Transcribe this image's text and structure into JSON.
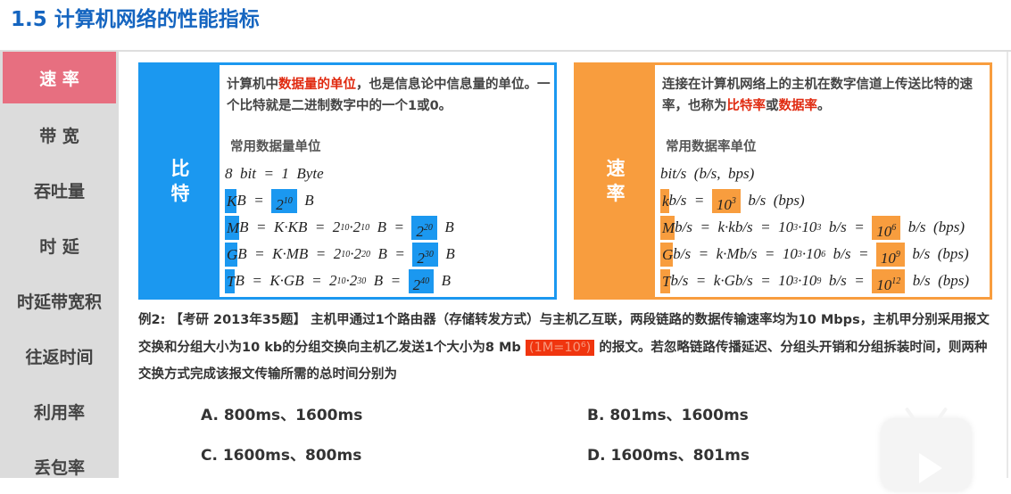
{
  "title": "1.5 计算机网络的性能指标",
  "sidebar": {
    "items": [
      {
        "label": "速 率",
        "active": true
      },
      {
        "label": "带 宽"
      },
      {
        "label": "吞吐量"
      },
      {
        "label": "时 延"
      },
      {
        "label": "时延带宽积"
      },
      {
        "label": "往返时间"
      },
      {
        "label": "利用率"
      },
      {
        "label": "丢包率"
      }
    ]
  },
  "bit_box": {
    "strip": [
      "比",
      "特"
    ],
    "desc_pre": "计算机中",
    "desc_red": "数据量的单位",
    "desc_post": "，也是信息论中信息量的单位。一个比特就是二进制数字中的一个1或0。",
    "sub": "常用数据量单位",
    "rows": [
      [
        [
          "t",
          "8  bit  =  1  Byte"
        ]
      ],
      [
        [
          "hl",
          "K"
        ],
        [
          "t",
          "B  =  "
        ],
        [
          "bx",
          "2",
          "10"
        ],
        [
          "t",
          "  B"
        ]
      ],
      [
        [
          "hl",
          "M"
        ],
        [
          "t",
          "B  =  K·KB  =  2"
        ],
        [
          "s",
          "10"
        ],
        [
          "t",
          "·2"
        ],
        [
          "s",
          "10"
        ],
        [
          "t",
          "  B  =  "
        ],
        [
          "bx",
          "2",
          "20"
        ],
        [
          "t",
          "  B"
        ]
      ],
      [
        [
          "hl",
          "G"
        ],
        [
          "t",
          "B  =  K·MB  =  2"
        ],
        [
          "s",
          "10"
        ],
        [
          "t",
          "·2"
        ],
        [
          "s",
          "20"
        ],
        [
          "t",
          "  B  =  "
        ],
        [
          "bx",
          "2",
          "30"
        ],
        [
          "t",
          "  B"
        ]
      ],
      [
        [
          "hl",
          "T"
        ],
        [
          "t",
          "B  =  K·GB  =  2"
        ],
        [
          "s",
          "10"
        ],
        [
          "t",
          "·2"
        ],
        [
          "s",
          "30"
        ],
        [
          "t",
          "  B  =  "
        ],
        [
          "bx",
          "2",
          "40"
        ],
        [
          "t",
          "  B"
        ]
      ]
    ]
  },
  "rate_box": {
    "strip": [
      "速",
      "率"
    ],
    "desc_pre": "连接在计算机网络上的主机在数字信道上传送比特的速率，也称为",
    "desc_red": "比特率",
    "desc_mid": "或",
    "desc_red2": "数据率",
    "desc_post": "。",
    "sub": "常用数据率单位",
    "rows": [
      [
        [
          "t",
          "bit/s  (b/s,  bps)"
        ]
      ],
      [
        [
          "hl",
          "k"
        ],
        [
          "t",
          "b/s  =  "
        ],
        [
          "bx",
          "10",
          "3"
        ],
        [
          "t",
          "  b/s  (bps)"
        ]
      ],
      [
        [
          "hl",
          "M"
        ],
        [
          "t",
          "b/s  =  k·kb/s  =  10"
        ],
        [
          "s",
          "3"
        ],
        [
          "t",
          "·10"
        ],
        [
          "s",
          "3"
        ],
        [
          "t",
          "  b/s  =  "
        ],
        [
          "bx",
          "10",
          "6"
        ],
        [
          "t",
          "  b/s  (bps)"
        ]
      ],
      [
        [
          "hl",
          "G"
        ],
        [
          "t",
          "b/s  =  k·Mb/s  =  10"
        ],
        [
          "s",
          "3"
        ],
        [
          "t",
          "·10"
        ],
        [
          "s",
          "6"
        ],
        [
          "t",
          "  b/s  =  "
        ],
        [
          "bx",
          "10",
          "9"
        ],
        [
          "t",
          "  b/s  (bps)"
        ]
      ],
      [
        [
          "hl",
          "T"
        ],
        [
          "t",
          "b/s  =  k·Gb/s  =  10"
        ],
        [
          "s",
          "3"
        ],
        [
          "t",
          "·10"
        ],
        [
          "s",
          "9"
        ],
        [
          "t",
          "  b/s  =  "
        ],
        [
          "bx",
          "10",
          "12"
        ],
        [
          "t",
          "  b/s  (bps)"
        ]
      ]
    ]
  },
  "question": {
    "pre": "例2: 【考研 2013年35题】 主机甲通过1个路由器（存储转发方式）与主机乙互联，两段链路的数据传输速率均为10 Mbps，主机甲分别采用报文交换和分组大小为10  kb的分组交换向主机乙发送1个大小为8  Mb ",
    "tag": "(1M=10⁶)",
    "post": " 的报文。若忽略链路传播延迟、分组头开销和分组拆装时间，则两种交换方式完成该报文传输所需的总时间分别为"
  },
  "options": {
    "a": "A. 800ms、1600ms",
    "b": "B. 801ms、1600ms",
    "c": "C. 1600ms、800ms",
    "d": "D. 1600ms、801ms"
  }
}
